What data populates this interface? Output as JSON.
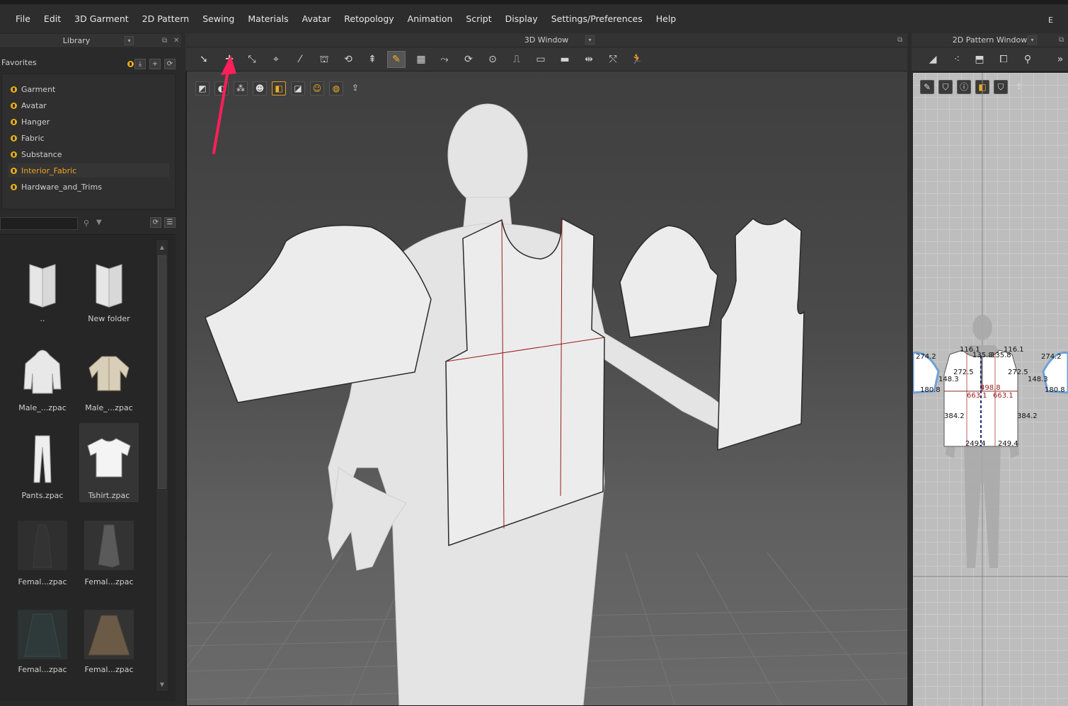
{
  "menu": [
    "File",
    "Edit",
    "3D Garment",
    "2D Pattern",
    "Sewing",
    "Materials",
    "Avatar",
    "Retopology",
    "Animation",
    "Script",
    "Display",
    "Settings/Preferences",
    "Help"
  ],
  "menu_edge": "E",
  "library": {
    "title": "Library",
    "favorites_label": "Favorites",
    "favorites": [
      "Garment",
      "Avatar",
      "Hanger",
      "Fabric",
      "Substance",
      "Interior_Fabric",
      "Hardware_and_Trims"
    ],
    "selected_favorite": "Interior_Fabric",
    "files": [
      {
        "label": "..",
        "icon": "folder-up-icon"
      },
      {
        "label": "New folder",
        "icon": "folder-icon"
      },
      {
        "label": "Male_...zpac",
        "icon": "hoodie-thumb"
      },
      {
        "label": "Male_...zpac",
        "icon": "jacket-thumb"
      },
      {
        "label": "Pants.zpac",
        "icon": "pants-thumb"
      },
      {
        "label": "Tshirt.zpac",
        "icon": "tshirt-thumb",
        "selected": true
      },
      {
        "label": "Femal...zpac",
        "icon": "dress-thumb"
      },
      {
        "label": "Femal...zpac",
        "icon": "dress-thumb"
      },
      {
        "label": "Femal...zpac",
        "icon": "skirt-thumb"
      },
      {
        "label": "Femal...zpac",
        "icon": "skirt-thumb"
      }
    ]
  },
  "window3d": {
    "title": "3D Window"
  },
  "window2d": {
    "title": "2D Pattern Window",
    "dimensions": {
      "d1": "274.2",
      "d2": "116.1",
      "d3": "135.8",
      "d4": "135.8",
      "d5": "116.1",
      "d6": "274.2",
      "d7": "272.5",
      "d8": "272.5",
      "d9": "148.3",
      "d10": "148.3",
      "d11": "180.8",
      "d12": "180.8",
      "d13": "498.8",
      "d14": "663.1",
      "d15": "663.1",
      "d16": "384.2",
      "d17": "384.2",
      "d18": "249.4",
      "d19": "249.4"
    }
  },
  "colors": {
    "accent": "#f0a020",
    "annotation_arrow": "#ff1f5a",
    "seam": "#9a1b1b"
  }
}
